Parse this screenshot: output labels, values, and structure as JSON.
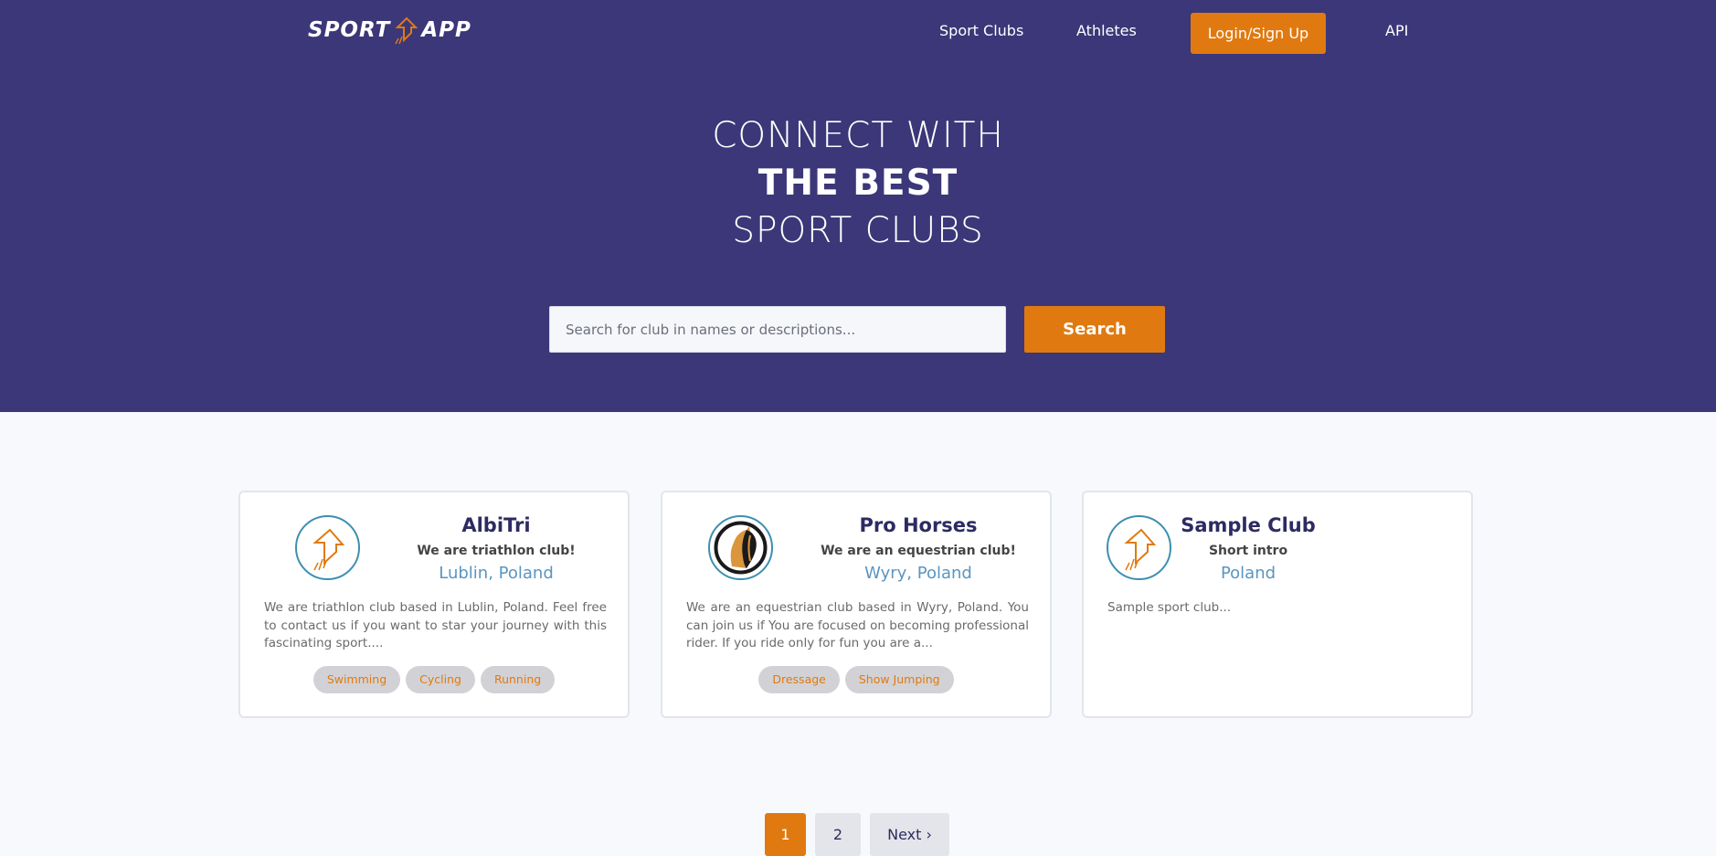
{
  "brand": {
    "left": "SPORT",
    "right": "APP",
    "accent": "#e07a10",
    "primary": "#3b3778"
  },
  "nav": {
    "sport_clubs": "Sport Clubs",
    "athletes": "Athletes",
    "login": "Login/Sign Up",
    "api": "API"
  },
  "hero": {
    "line1": "CONNECT WITH",
    "line2": "THE BEST",
    "line3": "SPORT CLUBS"
  },
  "search": {
    "placeholder": "Search for club in names or descriptions...",
    "button": "Search"
  },
  "clubs": [
    {
      "name": "AlbiTri",
      "intro": "We are triathlon club!",
      "location": "Lublin, Poland",
      "description": "We are triathlon club based in Lublin, Poland. Feel free to contact us if you want to star your journey with this fascinating sport....",
      "logo_icon": "sportapp-arrow-icon",
      "tags": [
        "Swimming",
        "Cycling",
        "Running"
      ]
    },
    {
      "name": "Pro Horses",
      "intro": "We are an equestrian club!",
      "location": "Wyry, Poland",
      "description": "We are an equestrian club based in Wyry, Poland. You can join us if You are focused on becoming professional rider. If you ride only for fun you are a...",
      "logo_icon": "horse-head-icon",
      "tags": [
        "Dressage",
        "Show Jumping"
      ]
    },
    {
      "name": "Sample Club",
      "intro": "Short intro",
      "location": "Poland",
      "description": "Sample sport club...",
      "logo_icon": "sportapp-arrow-icon",
      "tags": []
    }
  ],
  "pagination": {
    "current": "1",
    "page2": "2",
    "next": "Next ›"
  }
}
